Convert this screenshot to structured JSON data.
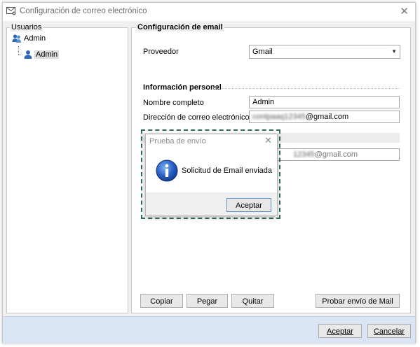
{
  "window": {
    "title": "Configuración de correo electrónico",
    "close_glyph": "✕",
    "title_icon": "envelope-gear-icon"
  },
  "users": {
    "group_label": "Usuarios",
    "root_label": "Admin",
    "child_label": "Admin"
  },
  "email_config": {
    "group_label": "Configuración de email",
    "provider_label": "Proveedor",
    "provider_value": "Gmail",
    "personal_section": "Información personal",
    "full_name_label": "Nombre completo",
    "full_name_value": "Admin",
    "email_label": "Dirección de correo electrónico",
    "email_blurred": "contpaaq12345",
    "email_domain": "@gmail.com",
    "second_email_blurred": "12345",
    "second_email_domain": "@gmail.com"
  },
  "buttons": {
    "copy": "Copiar",
    "paste": "Pegar",
    "remove": "Quitar",
    "test_send": "Probar envío de Mail",
    "accept": "Aceptar",
    "cancel": "Cancelar"
  },
  "dialog": {
    "title": "Prueba de envío",
    "close_glyph": "✕",
    "message": "Solicitud de Email enviada",
    "accept": "Aceptar",
    "icon": "info-icon",
    "highlight_color": "#2e6b5a"
  },
  "colors": {
    "bottom_bar": "#dae5f3",
    "panel": "#f0f0f0"
  }
}
